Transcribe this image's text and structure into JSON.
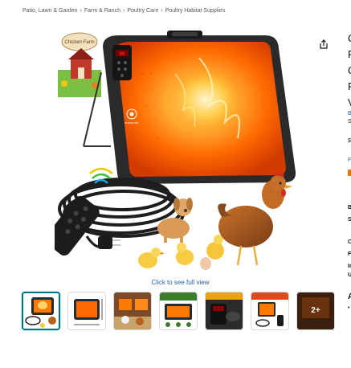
{
  "breadcrumb": {
    "items": [
      "Patio, Lawn & Garden",
      "Farm & Ranch",
      "Poultry Care",
      "Poultry Habitat Supplies"
    ],
    "separator": "›"
  },
  "product_image": {
    "badge_text": "Chicken Farm",
    "brand_mark": "BUSHOUSE"
  },
  "actions": {
    "share_icon": "share-icon"
  },
  "gallery": {
    "click_to_see_full": "Click to see full view",
    "more_count": "2+",
    "selected_index": 0,
    "thumbnails": [
      "product-main-thumbnail",
      "panel-dimensions-thumbnail",
      "coop-usage-thumbnail",
      "safety-features-thumbnail",
      "dual-control-thumbnail",
      "easy-to-use-thumbnail",
      "more-images-thumbnail"
    ]
  },
  "right_column": {
    "title_lines": [
      "C",
      "F",
      "C",
      "F",
      "V"
    ],
    "brand_lines": [
      "B",
      "S"
    ],
    "price_symbol": "$",
    "link_char": "F",
    "spec_lines": [
      "B",
      "S"
    ],
    "detail_lines": [
      "C",
      "F",
      "Ir",
      "U"
    ],
    "about_heading": "A",
    "bullet": "•"
  },
  "colors": {
    "link": "#2162a1",
    "selected_border": "#007185",
    "panel_dark": "#2a2a2a",
    "heat_orange": "#ff7a00",
    "text_secondary": "#565959"
  }
}
